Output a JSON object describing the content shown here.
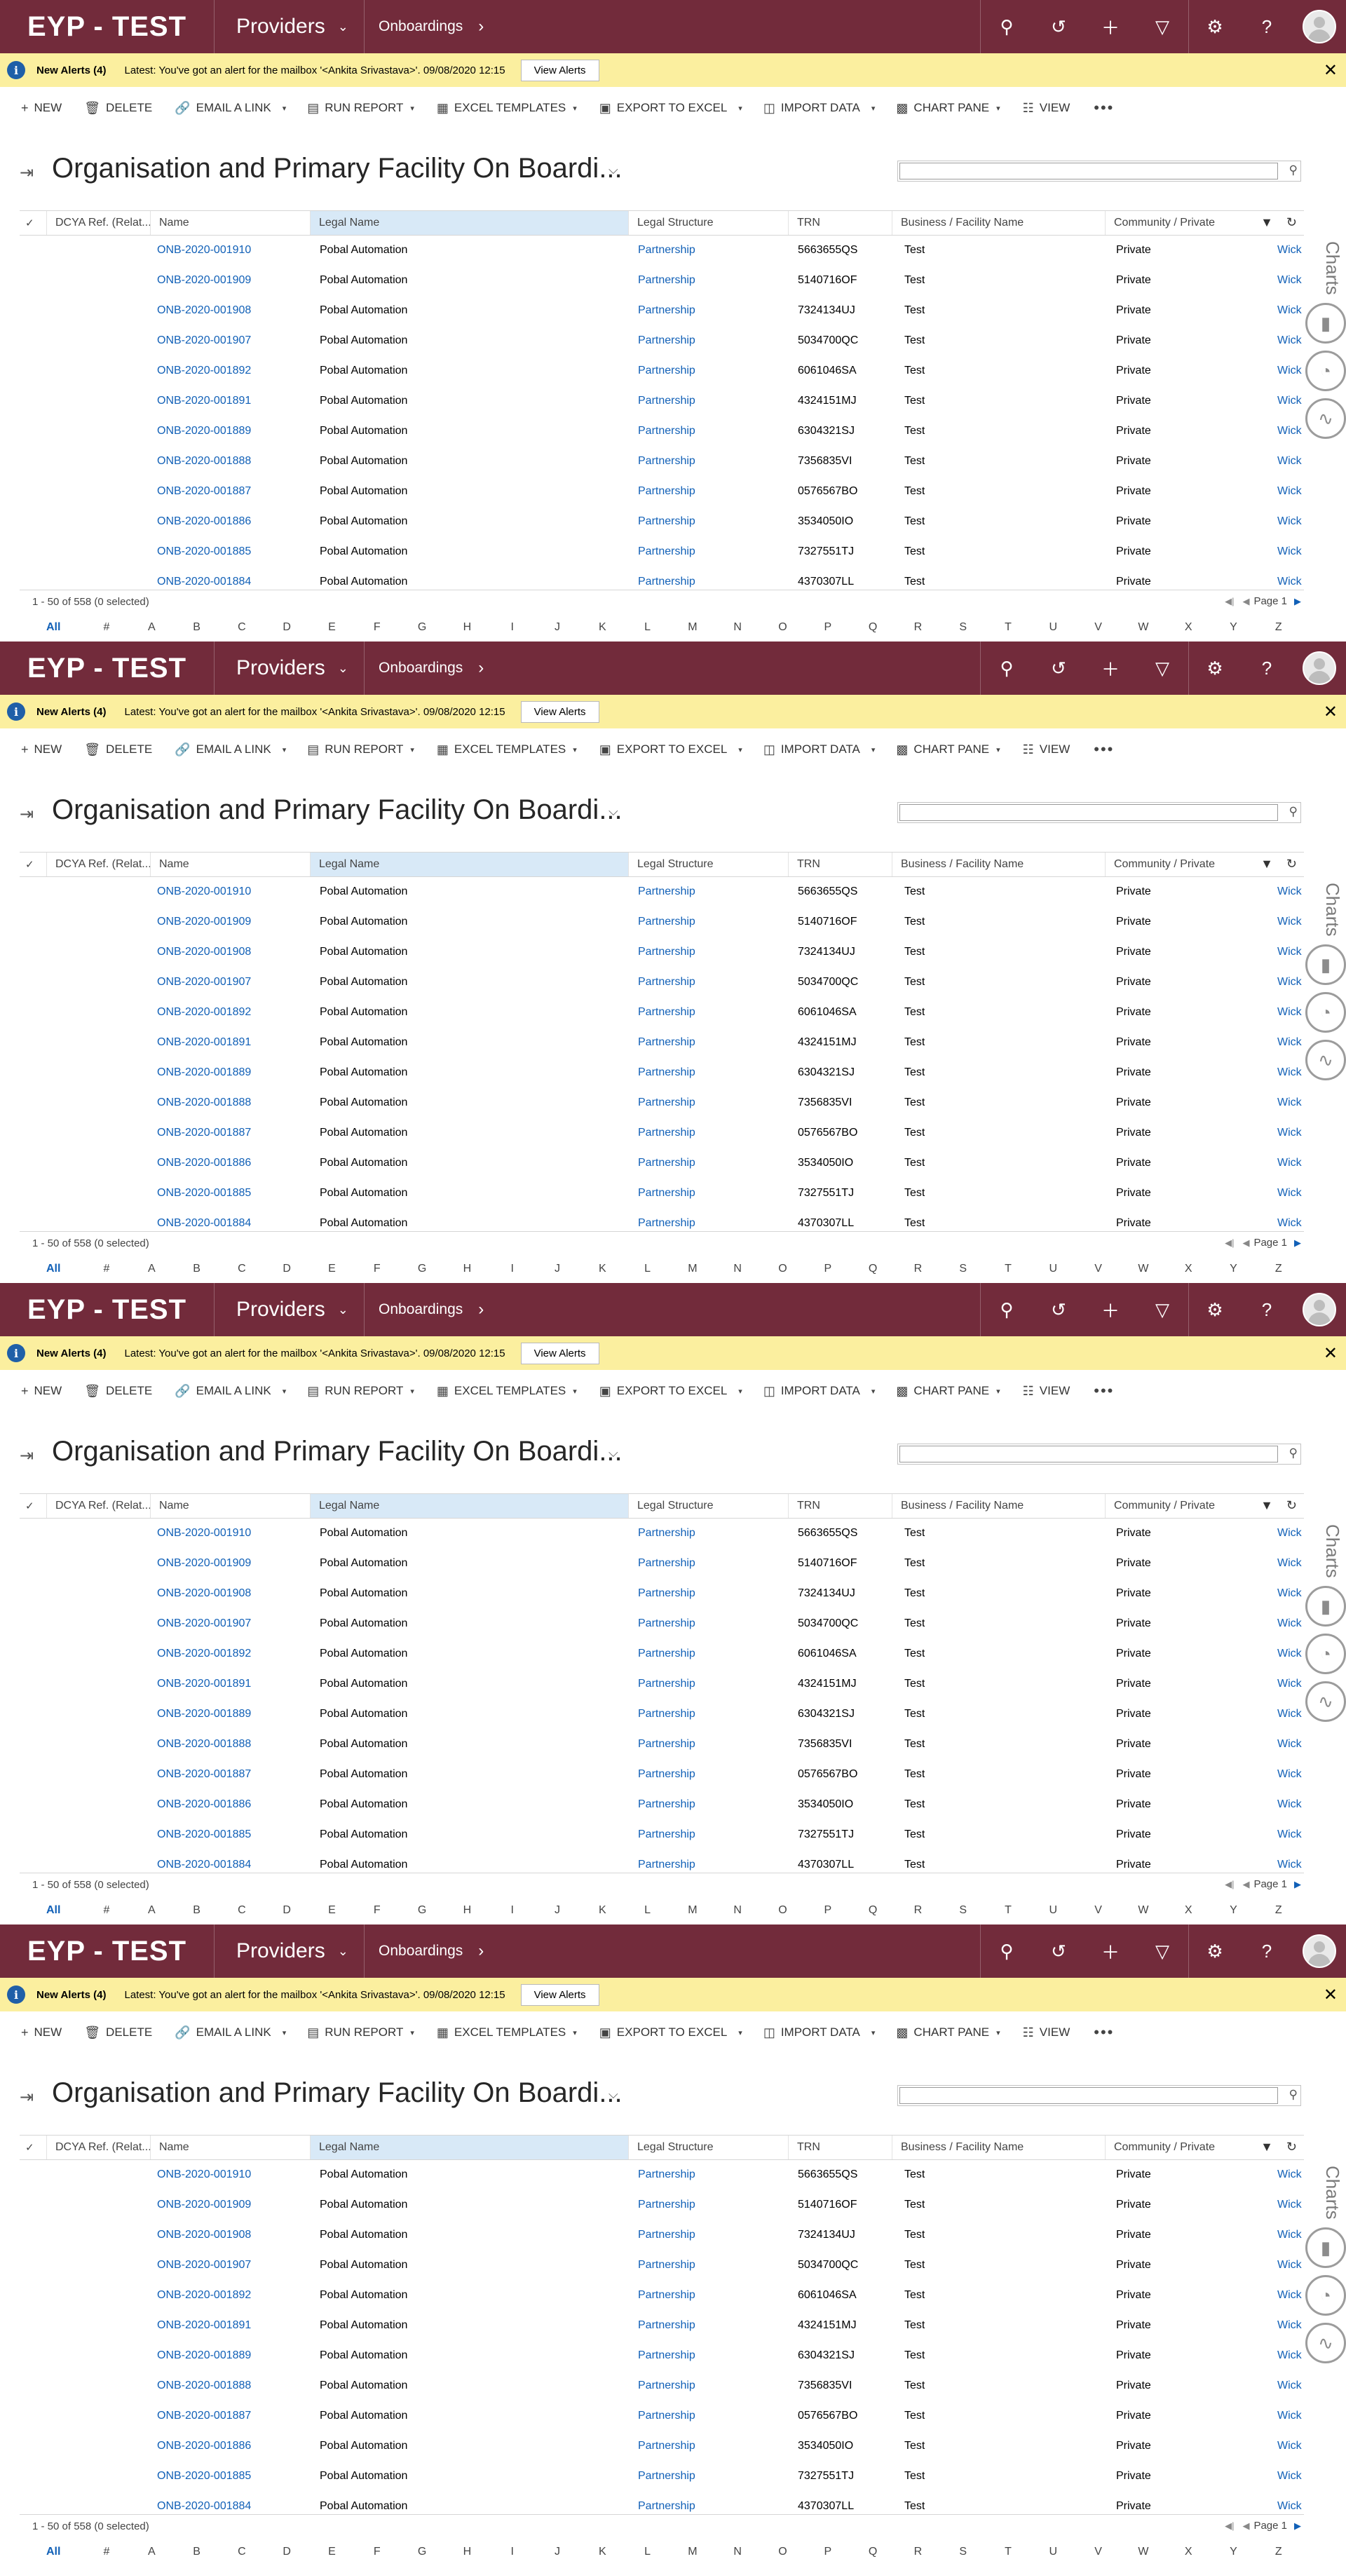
{
  "nav": {
    "brand": "EYP - TEST",
    "area": "Providers",
    "entity": "Onboardings",
    "icons": [
      "search-icon",
      "history-icon",
      "plus-icon",
      "filter-icon",
      "gear-icon",
      "help-icon",
      "user-avatar"
    ]
  },
  "alert": {
    "title": "New Alerts (4)",
    "text": "Latest: You've got an alert for the mailbox '<Ankita Srivastava>'. 09/08/2020 12:15",
    "button": "View Alerts"
  },
  "commands": {
    "new": "NEW",
    "delete": "DELETE",
    "email_link": "EMAIL A LINK",
    "run_report": "RUN REPORT",
    "excel_templates": "EXCEL TEMPLATES",
    "export_excel": "EXPORT TO EXCEL",
    "import_data": "IMPORT DATA",
    "chart_pane": "CHART PANE",
    "view": "VIEW"
  },
  "view": {
    "title": "Organisation and Primary Facility On Boardi...",
    "search_value": ""
  },
  "grid": {
    "columns": [
      "DCYA Ref. (Relat...",
      "Name",
      "Legal Name",
      "Legal Structure",
      "TRN",
      "Business / Facility Name",
      "Community / Private"
    ],
    "rows": [
      {
        "name": "ONB-2020-001910",
        "legal_name": "Pobal Automation",
        "structure": "Partnership",
        "trn": "5663655QS",
        "facility": "Test",
        "community": "Private",
        "extra": "Wick"
      },
      {
        "name": "ONB-2020-001909",
        "legal_name": "Pobal Automation",
        "structure": "Partnership",
        "trn": "5140716OF",
        "facility": "Test",
        "community": "Private",
        "extra": "Wick"
      },
      {
        "name": "ONB-2020-001908",
        "legal_name": "Pobal Automation",
        "structure": "Partnership",
        "trn": "7324134UJ",
        "facility": "Test",
        "community": "Private",
        "extra": "Wick"
      },
      {
        "name": "ONB-2020-001907",
        "legal_name": "Pobal Automation",
        "structure": "Partnership",
        "trn": "5034700QC",
        "facility": "Test",
        "community": "Private",
        "extra": "Wick"
      },
      {
        "name": "ONB-2020-001892",
        "legal_name": "Pobal Automation",
        "structure": "Partnership",
        "trn": "6061046SA",
        "facility": "Test",
        "community": "Private",
        "extra": "Wick"
      },
      {
        "name": "ONB-2020-001891",
        "legal_name": "Pobal Automation",
        "structure": "Partnership",
        "trn": "4324151MJ",
        "facility": "Test",
        "community": "Private",
        "extra": "Wick"
      },
      {
        "name": "ONB-2020-001889",
        "legal_name": "Pobal Automation",
        "structure": "Partnership",
        "trn": "6304321SJ",
        "facility": "Test",
        "community": "Private",
        "extra": "Wick"
      },
      {
        "name": "ONB-2020-001888",
        "legal_name": "Pobal Automation",
        "structure": "Partnership",
        "trn": "7356835VI",
        "facility": "Test",
        "community": "Private",
        "extra": "Wick"
      },
      {
        "name": "ONB-2020-001887",
        "legal_name": "Pobal Automation",
        "structure": "Partnership",
        "trn": "0576567BO",
        "facility": "Test",
        "community": "Private",
        "extra": "Wick"
      },
      {
        "name": "ONB-2020-001886",
        "legal_name": "Pobal Automation",
        "structure": "Partnership",
        "trn": "3534050IO",
        "facility": "Test",
        "community": "Private",
        "extra": "Wick"
      },
      {
        "name": "ONB-2020-001885",
        "legal_name": "Pobal Automation",
        "structure": "Partnership",
        "trn": "7327551TJ",
        "facility": "Test",
        "community": "Private",
        "extra": "Wick"
      },
      {
        "name": "ONB-2020-001884",
        "legal_name": "Pobal Automation",
        "structure": "Partnership",
        "trn": "4370307LL",
        "facility": "Test",
        "community": "Private",
        "extra": "Wick"
      }
    ],
    "footer": "1 - 50 of 558 (0 selected)",
    "page": "Page 1"
  },
  "jump_letters": [
    "All",
    "#",
    "A",
    "B",
    "C",
    "D",
    "E",
    "F",
    "G",
    "H",
    "I",
    "J",
    "K",
    "L",
    "M",
    "N",
    "O",
    "P",
    "Q",
    "R",
    "S",
    "T",
    "U",
    "V",
    "W",
    "X",
    "Y",
    "Z"
  ],
  "charts_label": "Charts",
  "colors": {
    "nav_bg": "#722b3b",
    "alert_bg": "#fbef9f",
    "link": "#1160b7",
    "selected_col": "#d8e9f7"
  }
}
